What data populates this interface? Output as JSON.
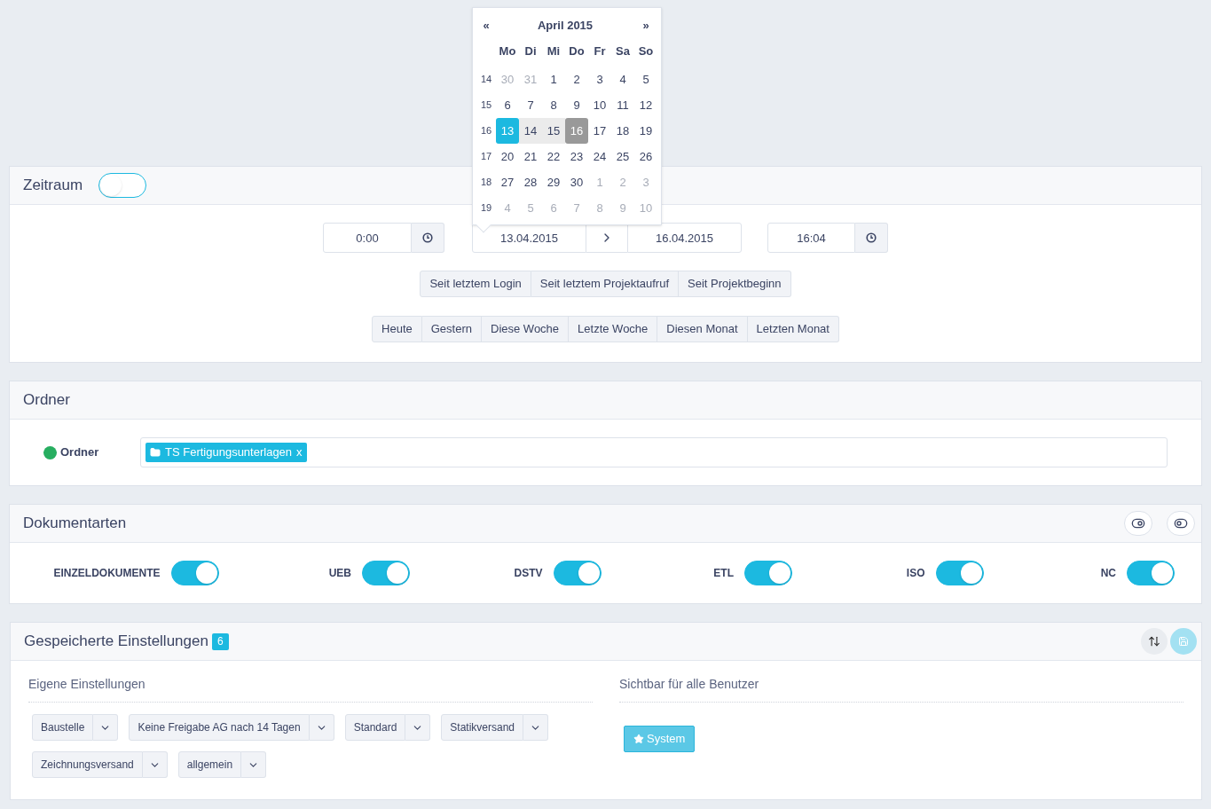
{
  "calendar": {
    "prev": "«",
    "title": "April 2015",
    "next": "»",
    "weekdays": [
      "Mo",
      "Di",
      "Mi",
      "Do",
      "Fr",
      "Sa",
      "So"
    ],
    "weeks": [
      {
        "number": "14",
        "days": [
          {
            "label": "30",
            "muted": true,
            "selected": false,
            "in_range": false,
            "range_end": false
          },
          {
            "label": "31",
            "muted": true,
            "selected": false,
            "in_range": false,
            "range_end": false
          },
          {
            "label": "1",
            "muted": false,
            "selected": false,
            "in_range": false,
            "range_end": false
          },
          {
            "label": "2",
            "muted": false,
            "selected": false,
            "in_range": false,
            "range_end": false
          },
          {
            "label": "3",
            "muted": false,
            "selected": false,
            "in_range": false,
            "range_end": false
          },
          {
            "label": "4",
            "muted": false,
            "selected": false,
            "in_range": false,
            "range_end": false
          },
          {
            "label": "5",
            "muted": false,
            "selected": false,
            "in_range": false,
            "range_end": false
          }
        ]
      },
      {
        "number": "15",
        "days": [
          {
            "label": "6",
            "muted": false,
            "selected": false,
            "in_range": false,
            "range_end": false
          },
          {
            "label": "7",
            "muted": false,
            "selected": false,
            "in_range": false,
            "range_end": false
          },
          {
            "label": "8",
            "muted": false,
            "selected": false,
            "in_range": false,
            "range_end": false
          },
          {
            "label": "9",
            "muted": false,
            "selected": false,
            "in_range": false,
            "range_end": false
          },
          {
            "label": "10",
            "muted": false,
            "selected": false,
            "in_range": false,
            "range_end": false
          },
          {
            "label": "11",
            "muted": false,
            "selected": false,
            "in_range": false,
            "range_end": false
          },
          {
            "label": "12",
            "muted": false,
            "selected": false,
            "in_range": false,
            "range_end": false
          }
        ]
      },
      {
        "number": "16",
        "days": [
          {
            "label": "13",
            "muted": false,
            "selected": true,
            "in_range": false,
            "range_end": false
          },
          {
            "label": "14",
            "muted": false,
            "selected": false,
            "in_range": true,
            "range_end": false
          },
          {
            "label": "15",
            "muted": false,
            "selected": false,
            "in_range": true,
            "range_end": false
          },
          {
            "label": "16",
            "muted": false,
            "selected": false,
            "in_range": false,
            "range_end": true
          },
          {
            "label": "17",
            "muted": false,
            "selected": false,
            "in_range": false,
            "range_end": false
          },
          {
            "label": "18",
            "muted": false,
            "selected": false,
            "in_range": false,
            "range_end": false
          },
          {
            "label": "19",
            "muted": false,
            "selected": false,
            "in_range": false,
            "range_end": false
          }
        ]
      },
      {
        "number": "17",
        "days": [
          {
            "label": "20",
            "muted": false,
            "selected": false,
            "in_range": false,
            "range_end": false
          },
          {
            "label": "21",
            "muted": false,
            "selected": false,
            "in_range": false,
            "range_end": false
          },
          {
            "label": "22",
            "muted": false,
            "selected": false,
            "in_range": false,
            "range_end": false
          },
          {
            "label": "23",
            "muted": false,
            "selected": false,
            "in_range": false,
            "range_end": false
          },
          {
            "label": "24",
            "muted": false,
            "selected": false,
            "in_range": false,
            "range_end": false
          },
          {
            "label": "25",
            "muted": false,
            "selected": false,
            "in_range": false,
            "range_end": false
          },
          {
            "label": "26",
            "muted": false,
            "selected": false,
            "in_range": false,
            "range_end": false
          }
        ]
      },
      {
        "number": "18",
        "days": [
          {
            "label": "27",
            "muted": false,
            "selected": false,
            "in_range": false,
            "range_end": false
          },
          {
            "label": "28",
            "muted": false,
            "selected": false,
            "in_range": false,
            "range_end": false
          },
          {
            "label": "29",
            "muted": false,
            "selected": false,
            "in_range": false,
            "range_end": false
          },
          {
            "label": "30",
            "muted": false,
            "selected": false,
            "in_range": false,
            "range_end": false
          },
          {
            "label": "1",
            "muted": true,
            "selected": false,
            "in_range": false,
            "range_end": false
          },
          {
            "label": "2",
            "muted": true,
            "selected": false,
            "in_range": false,
            "range_end": false
          },
          {
            "label": "3",
            "muted": true,
            "selected": false,
            "in_range": false,
            "range_end": false
          }
        ]
      },
      {
        "number": "19",
        "days": [
          {
            "label": "4",
            "muted": true,
            "selected": false,
            "in_range": false,
            "range_end": false
          },
          {
            "label": "5",
            "muted": true,
            "selected": false,
            "in_range": false,
            "range_end": false
          },
          {
            "label": "6",
            "muted": true,
            "selected": false,
            "in_range": false,
            "range_end": false
          },
          {
            "label": "7",
            "muted": true,
            "selected": false,
            "in_range": false,
            "range_end": false
          },
          {
            "label": "8",
            "muted": true,
            "selected": false,
            "in_range": false,
            "range_end": false
          },
          {
            "label": "9",
            "muted": true,
            "selected": false,
            "in_range": false,
            "range_end": false
          },
          {
            "label": "10",
            "muted": true,
            "selected": false,
            "in_range": false,
            "range_end": false
          }
        ]
      }
    ]
  },
  "zeitraum": {
    "title": "Zeitraum",
    "on": false,
    "start_time": "0:00",
    "start_date": "13.04.2015",
    "end_date": "16.04.2015",
    "end_time": "16:04",
    "quick_rows": [
      [
        "Seit letztem Login",
        "Seit letztem Projektaufruf",
        "Seit Projektbeginn"
      ],
      [
        "Heute",
        "Gestern",
        "Diese Woche",
        "Letzte Woche",
        "Diesen Monat",
        "Letzten Monat"
      ]
    ]
  },
  "ordner": {
    "title": "Ordner",
    "label": "Ordner",
    "color": "#27ae60",
    "tags": [
      {
        "label": "TS Fertigungsunterlagen",
        "remove": "x"
      }
    ]
  },
  "dokumentarten": {
    "title": "Dokumentarten",
    "types": [
      {
        "label": "EINZELDOKUMENTE",
        "on": true
      },
      {
        "label": "UEB",
        "on": true
      },
      {
        "label": "DSTV",
        "on": true
      },
      {
        "label": "ETL",
        "on": true
      },
      {
        "label": "ISO",
        "on": true
      },
      {
        "label": "NC",
        "on": true
      }
    ]
  },
  "einstellungen": {
    "title": "Gespeicherte Einstellungen",
    "count": "6",
    "own": {
      "title": "Eigene Einstellungen",
      "items": [
        "Baustelle",
        "Keine Freigabe AG nach 14 Tagen",
        "Standard",
        "Statikversand",
        "Zeichnungsversand",
        "allgemein"
      ]
    },
    "shared": {
      "title": "Sichtbar für alle Benutzer",
      "items": [
        "System"
      ]
    }
  }
}
